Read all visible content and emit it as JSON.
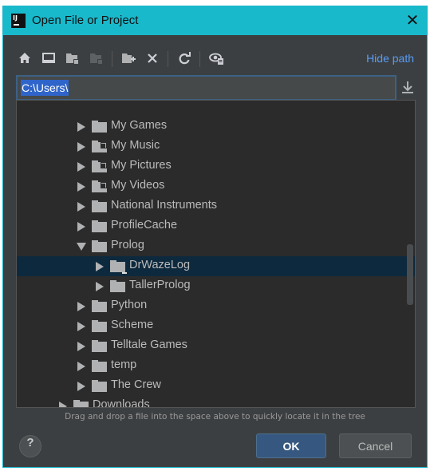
{
  "window": {
    "title": "Open File or Project",
    "logo": "IJ",
    "close": "✕"
  },
  "toolbar": {
    "icons": [
      "home-icon",
      "desktop-icon",
      "project-folder-icon",
      "module-folder-icon",
      "new-folder-icon",
      "delete-icon",
      "refresh-icon",
      "show-hidden-icon"
    ],
    "hide_path": "Hide path"
  },
  "path": {
    "value": "C:\\Users\\"
  },
  "tree": {
    "rows": [
      {
        "label": "My Games",
        "expanded": false,
        "icon": "folder"
      },
      {
        "label": "My Music",
        "expanded": false,
        "icon": "folder-link"
      },
      {
        "label": "My Pictures",
        "expanded": false,
        "icon": "folder-link"
      },
      {
        "label": "My Videos",
        "expanded": false,
        "icon": "folder-link"
      },
      {
        "label": "National Instruments",
        "expanded": false,
        "icon": "folder"
      },
      {
        "label": "ProfileCache",
        "expanded": false,
        "icon": "folder"
      },
      {
        "label": "Prolog",
        "expanded": true,
        "icon": "folder"
      },
      {
        "label": "DrWazeLog",
        "expanded": false,
        "icon": "folder-module",
        "selected": true
      },
      {
        "label": "TallerProlog",
        "expanded": false,
        "icon": "folder"
      },
      {
        "label": "Python",
        "expanded": false,
        "icon": "folder"
      },
      {
        "label": "Scheme",
        "expanded": false,
        "icon": "folder"
      },
      {
        "label": "Telltale Games",
        "expanded": false,
        "icon": "folder"
      },
      {
        "label": "temp",
        "expanded": false,
        "icon": "folder"
      },
      {
        "label": "The Crew",
        "expanded": false,
        "icon": "folder"
      },
      {
        "label": "Downloads",
        "expanded": false,
        "icon": "folder"
      }
    ]
  },
  "hint": "Drag and drop a file into the space above to quickly locate it in the tree",
  "buttons": {
    "help": "?",
    "ok": "OK",
    "cancel": "Cancel"
  },
  "colors": {
    "titlebar": "#19b9cc",
    "accent": "#589df6",
    "selection": "#0d293e",
    "ok": "#365880"
  }
}
